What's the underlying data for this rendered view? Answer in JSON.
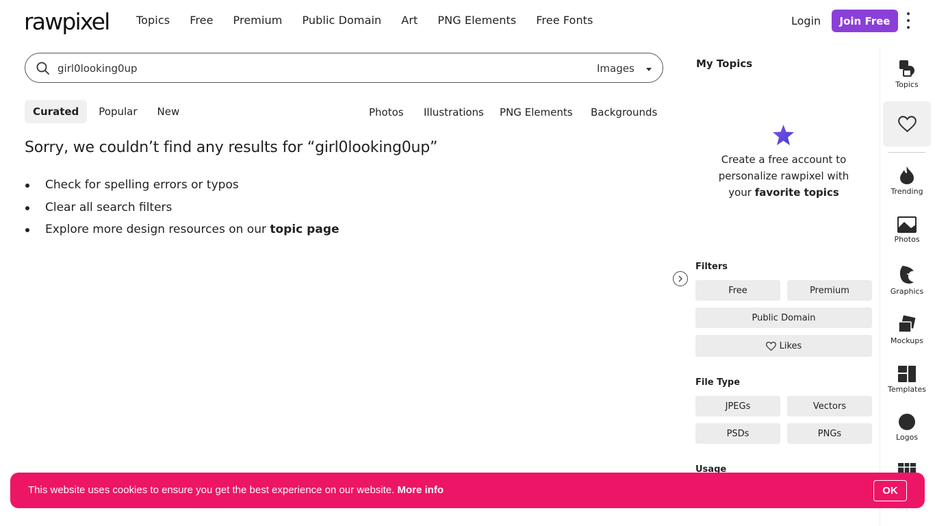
{
  "header": {
    "logo": "rawpixel",
    "nav": [
      "Topics",
      "Free",
      "Premium",
      "Public Domain",
      "Art",
      "PNG Elements",
      "Free Fonts"
    ],
    "login": "Login",
    "join": "Join Free",
    "brand_color": "#8b3fd9"
  },
  "search": {
    "query": "girl0looking0up",
    "scope": "Images"
  },
  "sort_tabs": [
    "Curated",
    "Popular",
    "New"
  ],
  "type_tabs": [
    "Photos",
    "Illustrations",
    "PNG Elements",
    "Backgrounds"
  ],
  "results": {
    "sorry": "Sorry, we couldn’t find any results for “girl0looking0up”",
    "tips": [
      "Check for spelling errors or typos",
      "Clear all search filters"
    ],
    "tip3_prefix": "Explore more design resources on our",
    "tip3_link": "topic page"
  },
  "panel": {
    "my_topics": "My Topics",
    "promo_line1": "Create a free account to personalize rawpixel with",
    "promo_prefix": "your",
    "promo_bold": "favorite topics",
    "filters_title": "Filters",
    "filters": {
      "free": "Free",
      "premium": "Premium",
      "public_domain": "Public Domain",
      "likes": "Likes"
    },
    "file_type_title": "File Type",
    "file_types": {
      "jpegs": "JPEGs",
      "vectors": "Vectors",
      "psds": "PSDs",
      "pngs": "PNGs"
    },
    "usage_title": "Usage"
  },
  "rail": {
    "topics": "Topics",
    "trending": "Trending",
    "photos": "Photos",
    "graphics": "Graphics",
    "mockups": "Mockups",
    "templates": "Templates",
    "logos": "Logos"
  },
  "cookie": {
    "message": "This website uses cookies to ensure you get the best experience on our website.",
    "more_info": "More info",
    "ok": "OK",
    "color": "#ed1566"
  }
}
